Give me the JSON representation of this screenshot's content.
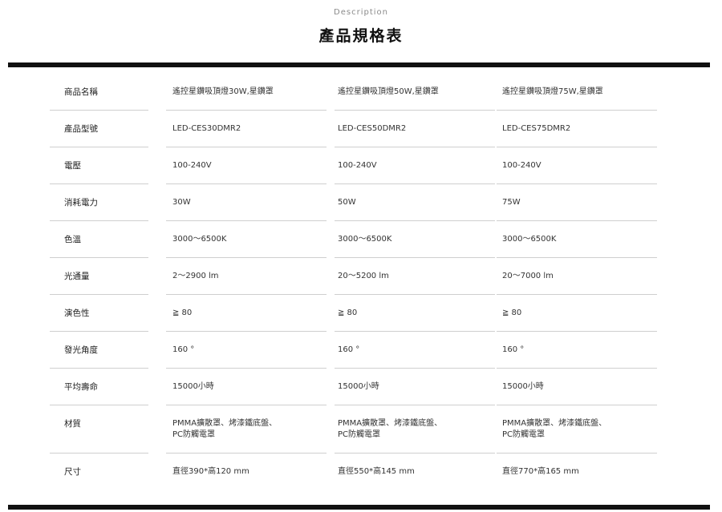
{
  "header": {
    "eyebrow": "Description",
    "title": "產品規格表"
  },
  "table": {
    "rows": [
      {
        "label": "商品名稱",
        "values": [
          "遙控星鑽吸頂燈30W,星鑽罩",
          "遙控星鑽吸頂燈50W,星鑽罩",
          "遙控星鑽吸頂燈75W,星鑽罩"
        ]
      },
      {
        "label": "產品型號",
        "values": [
          "LED-CES30DMR2",
          "LED-CES50DMR2",
          "LED-CES75DMR2"
        ]
      },
      {
        "label": "電壓",
        "values": [
          "100-240V",
          "100-240V",
          "100-240V"
        ]
      },
      {
        "label": "消耗電力",
        "values": [
          "30W",
          "50W",
          "75W"
        ]
      },
      {
        "label": "色溫",
        "values": [
          "3000～6500K",
          "3000～6500K",
          "3000～6500K"
        ]
      },
      {
        "label": "光通量",
        "values": [
          "2～2900 lm",
          "20～5200 lm",
          "20～7000 lm"
        ]
      },
      {
        "label": "演色性",
        "values": [
          "≧ 80",
          "≧ 80",
          "≧ 80"
        ]
      },
      {
        "label": "發光角度",
        "values": [
          "160 °",
          "160 °",
          "160 °"
        ]
      },
      {
        "label": "平均壽命",
        "values": [
          "15000小時",
          "15000小時",
          "15000小時"
        ]
      },
      {
        "label": "材質",
        "values": [
          "PMMA擴散罩、烤漆鐵底盤、",
          "PMMA擴散罩、烤漆鐵底盤、",
          "PMMA擴散罩、烤漆鐵底盤、"
        ],
        "values_line2": [
          "PC防觸電罩",
          "PC防觸電罩",
          "PC防觸電罩"
        ]
      },
      {
        "label": "尺寸",
        "values": [
          "直徑390*高120 mm",
          "直徑550*高145 mm",
          "直徑770*高165 mm"
        ]
      }
    ]
  }
}
